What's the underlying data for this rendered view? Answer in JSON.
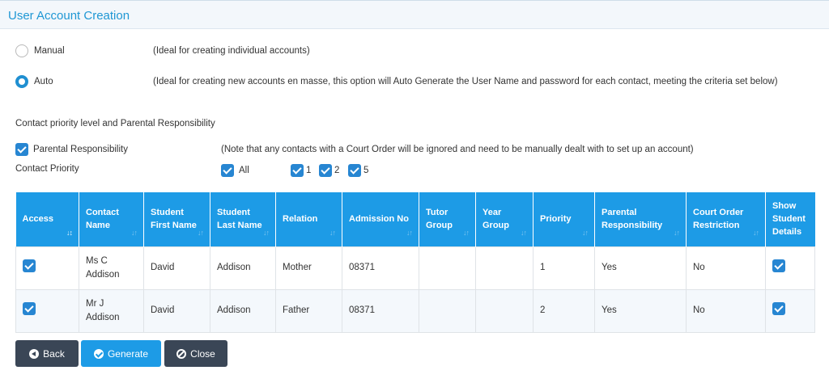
{
  "header": {
    "title": "User Account Creation"
  },
  "modes": {
    "manual": {
      "label": "Manual",
      "note": "(Ideal for creating individual accounts)",
      "selected": false
    },
    "auto": {
      "label": "Auto",
      "note": "(Ideal for creating new accounts en masse, this option will Auto Generate the User Name and password for each contact, meeting the criteria set below)",
      "selected": true
    }
  },
  "section_title": "Contact priority level and Parental Responsibility",
  "parental": {
    "label": "Parental Responsibility",
    "checked": true,
    "note": "(Note that any contacts with a Court Order will be ignored and need to be manually dealt with to set up an account)"
  },
  "priority": {
    "label": "Contact Priority",
    "options": [
      {
        "label": "All",
        "checked": true
      },
      {
        "label": "1",
        "checked": true
      },
      {
        "label": "2",
        "checked": true
      },
      {
        "label": "5",
        "checked": true
      }
    ]
  },
  "table": {
    "columns": [
      "Access",
      "Contact Name",
      "Student First Name",
      "Student Last Name",
      "Relation",
      "Admission No",
      "Tutor Group",
      "Year Group",
      "Priority",
      "Parental Responsibility",
      "Court Order Restriction",
      "Show Student Details"
    ],
    "rows": [
      {
        "access": true,
        "contact": "Ms C Addison",
        "first": "David",
        "last": "Addison",
        "relation": "Mother",
        "admission": "08371",
        "tutor": "",
        "year": "",
        "priority": "1",
        "parental": "Yes",
        "court": "No",
        "show": true
      },
      {
        "access": true,
        "contact": "Mr J Addison",
        "first": "David",
        "last": "Addison",
        "relation": "Father",
        "admission": "08371",
        "tutor": "",
        "year": "",
        "priority": "2",
        "parental": "Yes",
        "court": "No",
        "show": true
      }
    ]
  },
  "buttons": {
    "back": "Back",
    "generate": "Generate",
    "close": "Close"
  },
  "colors": {
    "accent": "#1d9be6",
    "dark_button": "#3a4656",
    "title": "#1f97d4"
  }
}
